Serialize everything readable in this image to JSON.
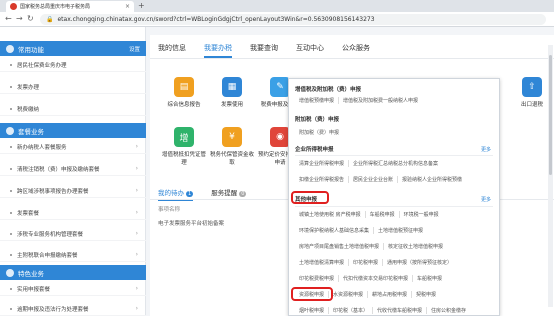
{
  "browser": {
    "tab_title": "国家税务总局重庆市电子税务局",
    "url": "etax.chongqing.chinatax.gov.cn/sword?ctrl=WBLoginGdgjCtrl_openLayout3Win&r=0.5630908156143273"
  },
  "sidebar": {
    "section1": {
      "label": "常用功能",
      "right": "设置"
    },
    "items1": [
      "居民社保费业务办理",
      "发票办理",
      "税费缴纳"
    ],
    "section2": {
      "label": "套餐业务"
    },
    "items2": [
      "新办纳税人套餐服务",
      "清税注销税（费）申报及缴纳套餐",
      "跨区域涉税事项报告办理套餐",
      "发票套餐",
      "涉税专业服务机构管理套餐",
      "主附税联合申报缴纳套餐"
    ],
    "section3": {
      "label": "特色业务"
    },
    "items3": [
      "实用申报套餐",
      "逾期申报及违法行为处理套餐"
    ]
  },
  "main": {
    "tabs": [
      "我的信息",
      "我要办税",
      "我要查询",
      "互动中心",
      "公众服务"
    ],
    "services_row1": [
      "综合信息报告",
      "发票使用",
      "税费申报及缴纳",
      "出口退税"
    ],
    "services_row2": [
      "增值税抵扣凭证管理",
      "税务代保管资金收取",
      "预约定价安排谈签申请"
    ],
    "todo_tabs": {
      "todo": "我的待办",
      "todo_count": "1",
      "reminder": "服务提醒",
      "reminder_count": "0"
    },
    "todo_header": "事项名称",
    "todo_item": "电子发票服务平台初始备案"
  },
  "popup": {
    "g1": "增值税及附加税（费）申报",
    "g1_items": [
      "增值税预缴申报",
      "增值税及附加税费一般纳税人申报"
    ],
    "g2": "附加税（费）申报",
    "g2_items": [
      "附加税（费）申报"
    ],
    "g3": "企业所得税申报",
    "g3_more": "更多",
    "g3_row1": [
      "清算企业所得税申报",
      "企业所得税汇总纳税总分机构信息备案"
    ],
    "g3_row2": [
      "扣缴企业所得税报告",
      "居民企业企业台账",
      "报验纳税人企业所得税预缴"
    ],
    "g4": "其他申报",
    "g4_more": "更多",
    "g4_row1": [
      "城镇土地使用税 房产税申报",
      "车船税申报",
      "环境税一般申报"
    ],
    "g4_row2": [
      "环境保护税纳税人基础信息采集",
      "土地增值税预征申报"
    ],
    "g4_row3": [
      "房地产项目尾盘销售土地增值税申报",
      "核定征收土地增值税申报"
    ],
    "g4_row4": [
      "土地增值税清算申报",
      "印花税申报",
      "通用申报（按所得预征核定）"
    ],
    "g4_row5": [
      "印花税费税申报",
      "代扣代缴资本交易印花税申报",
      "车船税申报"
    ],
    "g4_row6": [
      "资源税申报",
      "水资源税申报",
      "耕地占用税申报",
      "契税申报"
    ],
    "g4_row7": [
      "烟叶税申报",
      "印花税（基本）",
      "代收代缴车船税申报",
      "住房公积金缴存"
    ]
  },
  "colors": {
    "accent": "#2f86d6",
    "highlight": "#e02020"
  }
}
